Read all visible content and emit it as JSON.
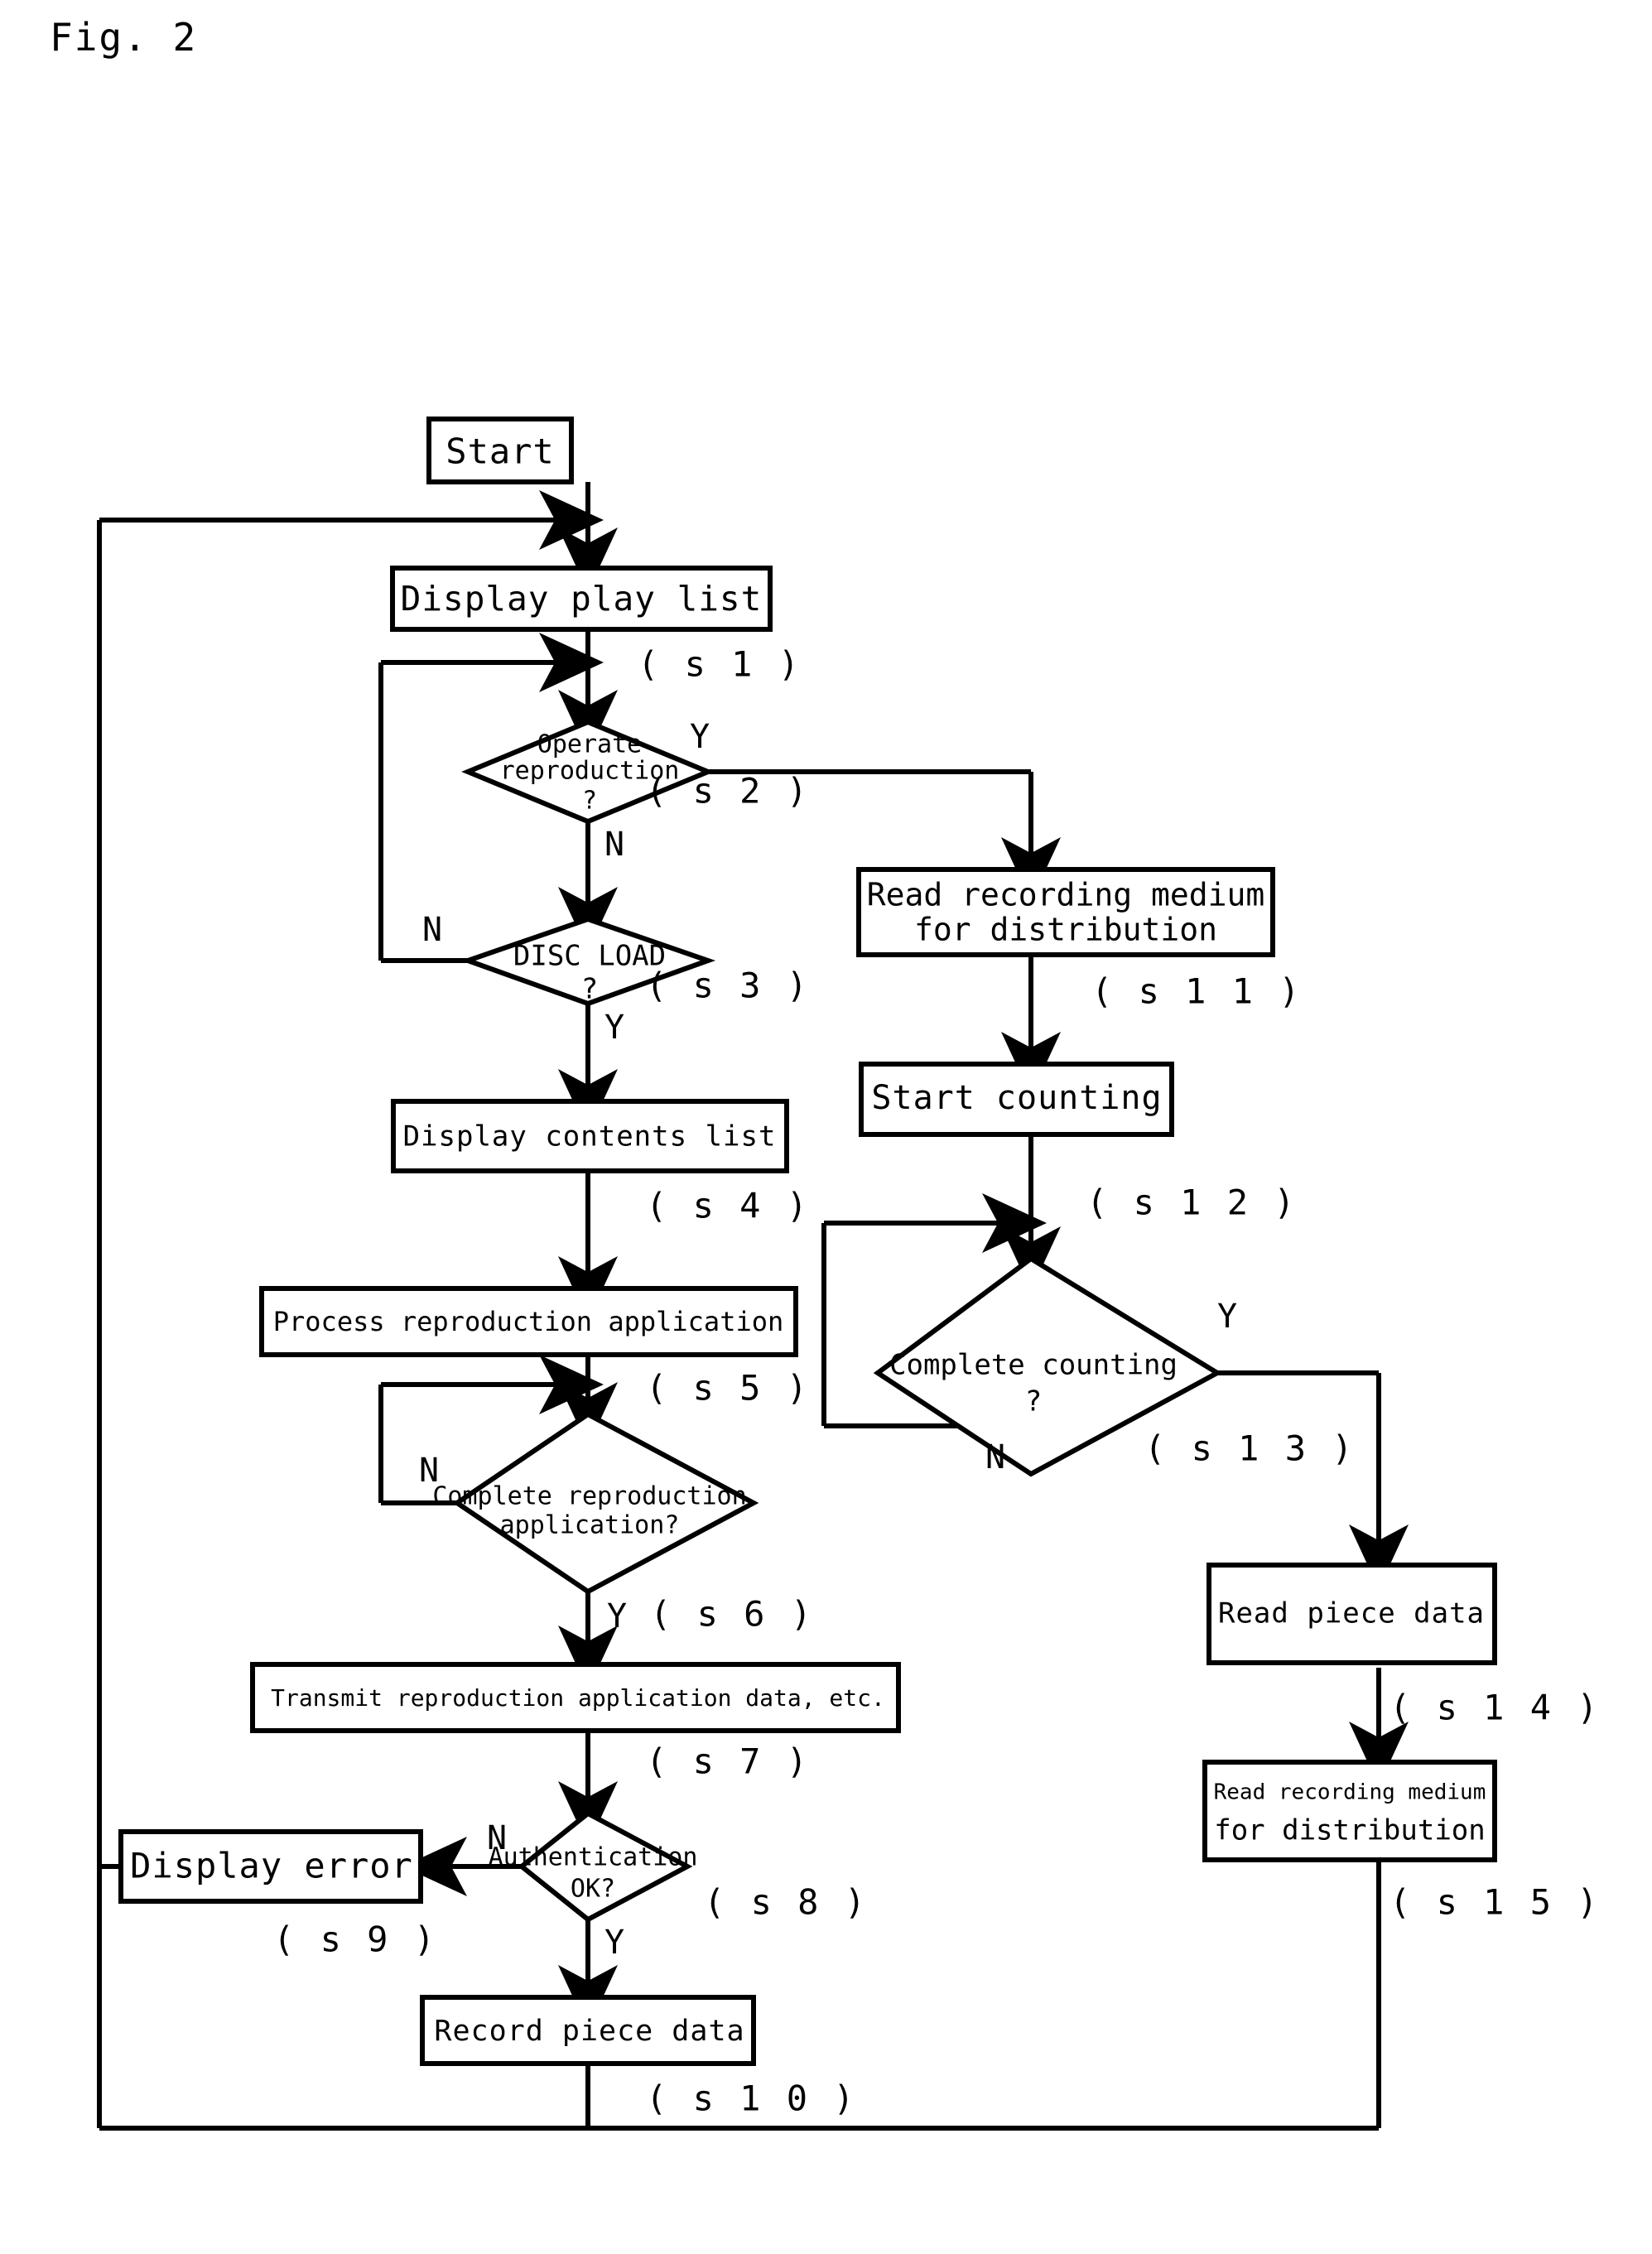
{
  "figure": {
    "label": "Fig. 2",
    "type": "flowchart"
  },
  "chart_data": {
    "type": "diagram",
    "title": "Fig. 2",
    "nodes": [
      {
        "id": "start",
        "shape": "rectangle",
        "label": "Start",
        "step": ""
      },
      {
        "id": "s1",
        "shape": "rectangle",
        "label": "Display play list",
        "step": "( s 1 )"
      },
      {
        "id": "s2",
        "shape": "diamond",
        "label": "Operate reproduction ?",
        "step": "( s 2 )"
      },
      {
        "id": "s3",
        "shape": "diamond",
        "label": "DISC LOAD ?",
        "step": "( s 3 )"
      },
      {
        "id": "s4",
        "shape": "rectangle",
        "label": "Display contents list",
        "step": "( s 4 )"
      },
      {
        "id": "s5",
        "shape": "rectangle",
        "label": "Process reproduction application",
        "step": "( s 5 )"
      },
      {
        "id": "s6",
        "shape": "diamond",
        "label": "Complete reproduction application?",
        "step": "( s 6 )"
      },
      {
        "id": "s7",
        "shape": "rectangle",
        "label": "Transmit reproduction application data, etc.",
        "step": "( s 7 )"
      },
      {
        "id": "s8",
        "shape": "diamond",
        "label": "Authentication OK?",
        "step": "( s 8 )"
      },
      {
        "id": "s9",
        "shape": "rectangle",
        "label": "Display error",
        "step": "( s 9 )"
      },
      {
        "id": "s10",
        "shape": "rectangle",
        "label": "Record piece data",
        "step": "( s 1 0 )"
      },
      {
        "id": "s11",
        "shape": "rectangle",
        "label": "Read recording medium for distribution",
        "step": "( s 1 1 )"
      },
      {
        "id": "s12",
        "shape": "rectangle",
        "label": "Start counting",
        "step": "( s 1 2 )"
      },
      {
        "id": "s13",
        "shape": "diamond",
        "label": "Complete counting ?",
        "step": "( s 1 3 )"
      },
      {
        "id": "s14",
        "shape": "rectangle",
        "label": "Read piece data",
        "step": "( s 1 4 )"
      },
      {
        "id": "s15",
        "shape": "rectangle",
        "label": "Read recording medium for distribution",
        "step": "( s 1 5 )"
      }
    ],
    "edges": [
      {
        "from": "start",
        "to": "s1",
        "label": ""
      },
      {
        "from": "s1",
        "to": "s2",
        "label": ""
      },
      {
        "from": "s2",
        "to": "s11",
        "label": "Y"
      },
      {
        "from": "s2",
        "to": "s3",
        "label": "N"
      },
      {
        "from": "s3",
        "to": "s2",
        "label": "N"
      },
      {
        "from": "s3",
        "to": "s4",
        "label": "Y"
      },
      {
        "from": "s4",
        "to": "s5",
        "label": ""
      },
      {
        "from": "s5",
        "to": "s6",
        "label": ""
      },
      {
        "from": "s6",
        "to": "s5",
        "label": "N"
      },
      {
        "from": "s6",
        "to": "s7",
        "label": "Y"
      },
      {
        "from": "s7",
        "to": "s8",
        "label": ""
      },
      {
        "from": "s8",
        "to": "s9",
        "label": "N"
      },
      {
        "from": "s8",
        "to": "s10",
        "label": "Y"
      },
      {
        "from": "s9",
        "to": "s1",
        "label": ""
      },
      {
        "from": "s10",
        "to": "s1",
        "label": ""
      },
      {
        "from": "s11",
        "to": "s12",
        "label": ""
      },
      {
        "from": "s12",
        "to": "s13",
        "label": ""
      },
      {
        "from": "s13",
        "to": "s12",
        "label": "N"
      },
      {
        "from": "s13",
        "to": "s14",
        "label": "Y"
      },
      {
        "from": "s14",
        "to": "s15",
        "label": ""
      },
      {
        "from": "s15",
        "to": "s1",
        "label": ""
      }
    ]
  },
  "labels": {
    "start": "Start",
    "s1_text": "Display play list",
    "s1_step": "( s 1 )",
    "s2_l1": "Operate",
    "s2_l2": "reproduction",
    "s2_l3": "?",
    "s2_step": "( s 2 )",
    "s2_yes": "Y",
    "s2_no": "N",
    "s3_l1": "DISC  LOAD",
    "s3_l2": "?",
    "s3_step": "( s 3 )",
    "s3_yes": "Y",
    "s3_no": "N",
    "s4_text": "Display contents list",
    "s4_step": "( s 4 )",
    "s5_text": "Process reproduction application",
    "s5_step": "( s 5 )",
    "s6_l1": "Complete reproduction",
    "s6_l2": "application?",
    "s6_step": "( s 6 )",
    "s6_yes": "Y",
    "s6_no": "N",
    "s7_text": "Transmit reproduction application data, etc.",
    "s7_step": "( s 7 )",
    "s8_l1": "Authentication",
    "s8_l2": "OK?",
    "s8_step": "( s 8 )",
    "s8_yes": "Y",
    "s8_no": "N",
    "s9_text": "Display error",
    "s9_step": "( s 9 )",
    "s10_text": "Record piece data",
    "s10_step": "( s 1 0 )",
    "s11_l1": "Read recording medium",
    "s11_l2": "for distribution",
    "s11_step": "( s 1 1 )",
    "s12_text": "Start counting",
    "s12_step": "( s 1 2 )",
    "s13_l1": "Complete counting",
    "s13_l2": "?",
    "s13_step": "( s 1 3 )",
    "s13_yes": "Y",
    "s13_no": "N",
    "s14_text": "Read piece data",
    "s14_step": "( s 1 4 )",
    "s15_l1": "Read recording medium",
    "s15_l2": "for distribution",
    "s15_step": "( s 1 5 )"
  }
}
